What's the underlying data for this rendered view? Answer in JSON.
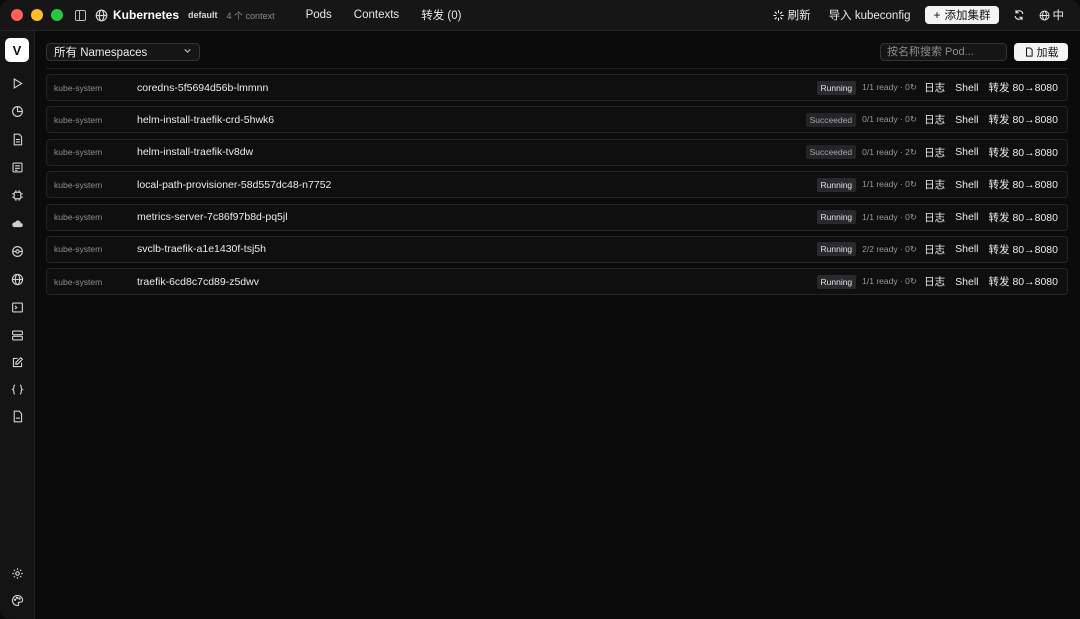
{
  "titlebar": {
    "app_title": "Kubernetes",
    "context_name": "default",
    "context_count": "4 个 context",
    "tabs": [
      {
        "label": "Pods"
      },
      {
        "label": "Contexts"
      },
      {
        "label": "转发 (0)"
      }
    ],
    "refresh_label": "刷新",
    "import_label": "导入 kubeconfig",
    "add_cluster_label": "添加集群",
    "lang_label": "中"
  },
  "rail": {
    "logo": "V",
    "icons": [
      "play-icon",
      "pie-chart-icon",
      "document-icon",
      "newspaper-icon",
      "chip-icon",
      "cloud-icon",
      "network-icon",
      "globe-icon",
      "terminal-icon",
      "server-icon",
      "edit-icon",
      "braces-icon",
      "file-icon",
      "settings-icon",
      "palette-icon"
    ]
  },
  "toolbar": {
    "namespace_selected": "所有 Namespaces",
    "search_placeholder": "按名称搜索 Pod...",
    "load_label": "加载"
  },
  "pods": [
    {
      "namespace": "kube-system",
      "name": "coredns-5f5694d56b-lmmnn",
      "status": "Running",
      "meta": "1/1 ready · 0↻",
      "logs": "日志",
      "shell": "Shell",
      "forward": "转发 80→8080"
    },
    {
      "namespace": "kube-system",
      "name": "helm-install-traefik-crd-5hwk6",
      "status": "Succeeded",
      "meta": "0/1 ready · 0↻",
      "logs": "日志",
      "shell": "Shell",
      "forward": "转发 80→8080"
    },
    {
      "namespace": "kube-system",
      "name": "helm-install-traefik-tv8dw",
      "status": "Succeeded",
      "meta": "0/1 ready · 2↻",
      "logs": "日志",
      "shell": "Shell",
      "forward": "转发 80→8080"
    },
    {
      "namespace": "kube-system",
      "name": "local-path-provisioner-58d557dc48-n7752",
      "status": "Running",
      "meta": "1/1 ready · 0↻",
      "logs": "日志",
      "shell": "Shell",
      "forward": "转发 80→8080"
    },
    {
      "namespace": "kube-system",
      "name": "metrics-server-7c86f97b8d-pq5jl",
      "status": "Running",
      "meta": "1/1 ready · 0↻",
      "logs": "日志",
      "shell": "Shell",
      "forward": "转发 80→8080"
    },
    {
      "namespace": "kube-system",
      "name": "svclb-traefik-a1e1430f-tsj5h",
      "status": "Running",
      "meta": "2/2 ready · 0↻",
      "logs": "日志",
      "shell": "Shell",
      "forward": "转发 80→8080"
    },
    {
      "namespace": "kube-system",
      "name": "traefik-6cd8c7cd89-z5dwv",
      "status": "Running",
      "meta": "1/1 ready · 0↻",
      "logs": "日志",
      "shell": "Shell",
      "forward": "转发 80→8080"
    }
  ]
}
